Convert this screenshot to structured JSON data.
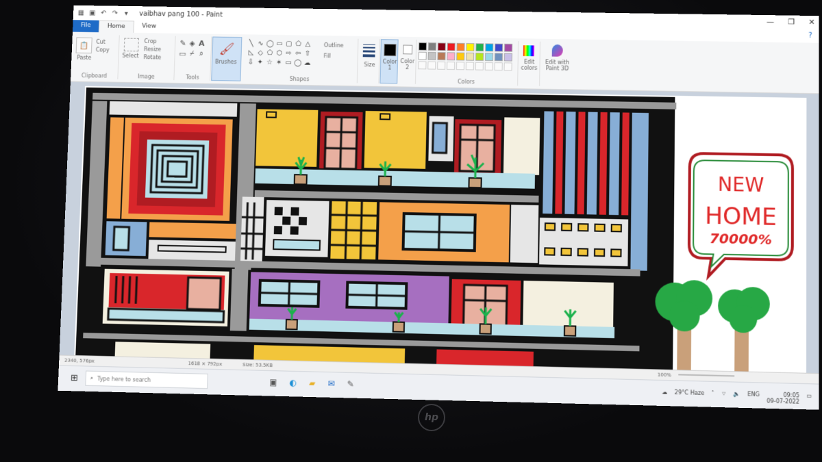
{
  "window": {
    "title": "vaibhav pang 100 - Paint",
    "controls": [
      "—",
      "❐",
      "✕"
    ]
  },
  "tabs": {
    "file": "File",
    "home": "Home",
    "view": "View"
  },
  "ribbon": {
    "clipboard": {
      "paste": "Paste",
      "cut": "Cut",
      "copy": "Copy",
      "label": "Clipboard"
    },
    "image": {
      "select": "Select",
      "crop": "Crop",
      "resize": "Resize",
      "rotate": "Rotate",
      "label": "Image"
    },
    "tools": {
      "label": "Tools"
    },
    "brushes": {
      "label": "Brushes"
    },
    "shapes": {
      "outline": "Outline",
      "fill": "Fill",
      "label": "Shapes"
    },
    "size": {
      "label": "Size"
    },
    "color1": "Color 1",
    "color2": "Color 2",
    "colors": {
      "label": "Colors",
      "palette_row1": [
        "#000000",
        "#7f7f7f",
        "#880015",
        "#ed1c24",
        "#ff7f27",
        "#fff200",
        "#22b14c",
        "#00a2e8",
        "#3f48cc",
        "#a349a4"
      ],
      "palette_row2": [
        "#ffffff",
        "#c3c3c3",
        "#b97a57",
        "#ffaec9",
        "#ffc90e",
        "#efe4b0",
        "#b5e61d",
        "#99d9ea",
        "#7092be",
        "#c8bfe7"
      ]
    },
    "edit_colors": "Edit colors",
    "edit_paint3d": "Edit with Paint 3D"
  },
  "drawing": {
    "sign": {
      "line1": "NEW",
      "line2": "HOME",
      "line3": "70000%"
    },
    "colors": {
      "outline": "#111111",
      "yellow": "#f2c53a",
      "orange": "#f4a04a",
      "red": "#d9262b",
      "darkred": "#b01c22",
      "lightblue": "#b8dfe8",
      "steelblue": "#87aed6",
      "purple": "#a66fc0",
      "pink": "#e8b0a0",
      "gray": "#9a9a9a",
      "green": "#1bb14c",
      "tree": "#27a845",
      "trunk": "#c9a07a",
      "signred": "#e02a2a",
      "signgreen": "#2a8c3a"
    }
  },
  "status": {
    "pos": "2340, 576px",
    "dims": "1618 × 792px",
    "size": "Size: 53.5KB",
    "zoom": "100%"
  },
  "taskbar": {
    "search_placeholder": "Type here to search",
    "weather": "29°C Haze",
    "lang": "ENG",
    "time": "09:05",
    "date": "09-07-2022"
  },
  "brand": "hp"
}
